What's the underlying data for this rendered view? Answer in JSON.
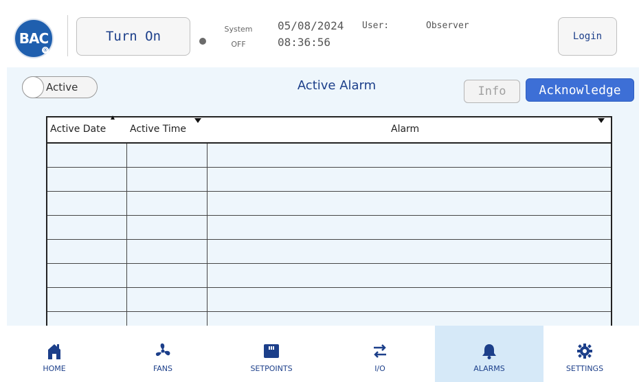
{
  "brand": {
    "logo_text": "BAC",
    "registered_mark": "®"
  },
  "header": {
    "turn_on_label": "Turn On",
    "system_label": "System",
    "system_state": "OFF",
    "date": "05/08/2024",
    "time": "08:36:56",
    "user_label": "User:",
    "user_name": "Observer",
    "login_label": "Login"
  },
  "toolbar": {
    "toggle_label": "Active",
    "page_title": "Active Alarm",
    "info_label": "Info",
    "acknowledge_label": "Acknowledge"
  },
  "table": {
    "columns": [
      "Active Date",
      "Active Time",
      "Alarm"
    ],
    "rows": [
      [],
      [],
      [],
      [],
      [],
      [],
      [],
      []
    ]
  },
  "nav": {
    "items": [
      {
        "label": "HOME",
        "icon": "home-icon"
      },
      {
        "label": "FANS",
        "icon": "fan-icon"
      },
      {
        "label": "SETPOINTS",
        "icon": "setpoints-icon"
      },
      {
        "label": "I/O",
        "icon": "io-arrows-icon"
      },
      {
        "label": "ALARMS",
        "icon": "bell-icon",
        "active": true
      },
      {
        "label": "SETTINGS",
        "icon": "gear-icon"
      }
    ]
  },
  "colors": {
    "accent": "#1c3f8a",
    "button_primary": "#3d6fd6",
    "content_bg": "#eef6fc",
    "nav_active_bg": "#d6e9f8"
  }
}
